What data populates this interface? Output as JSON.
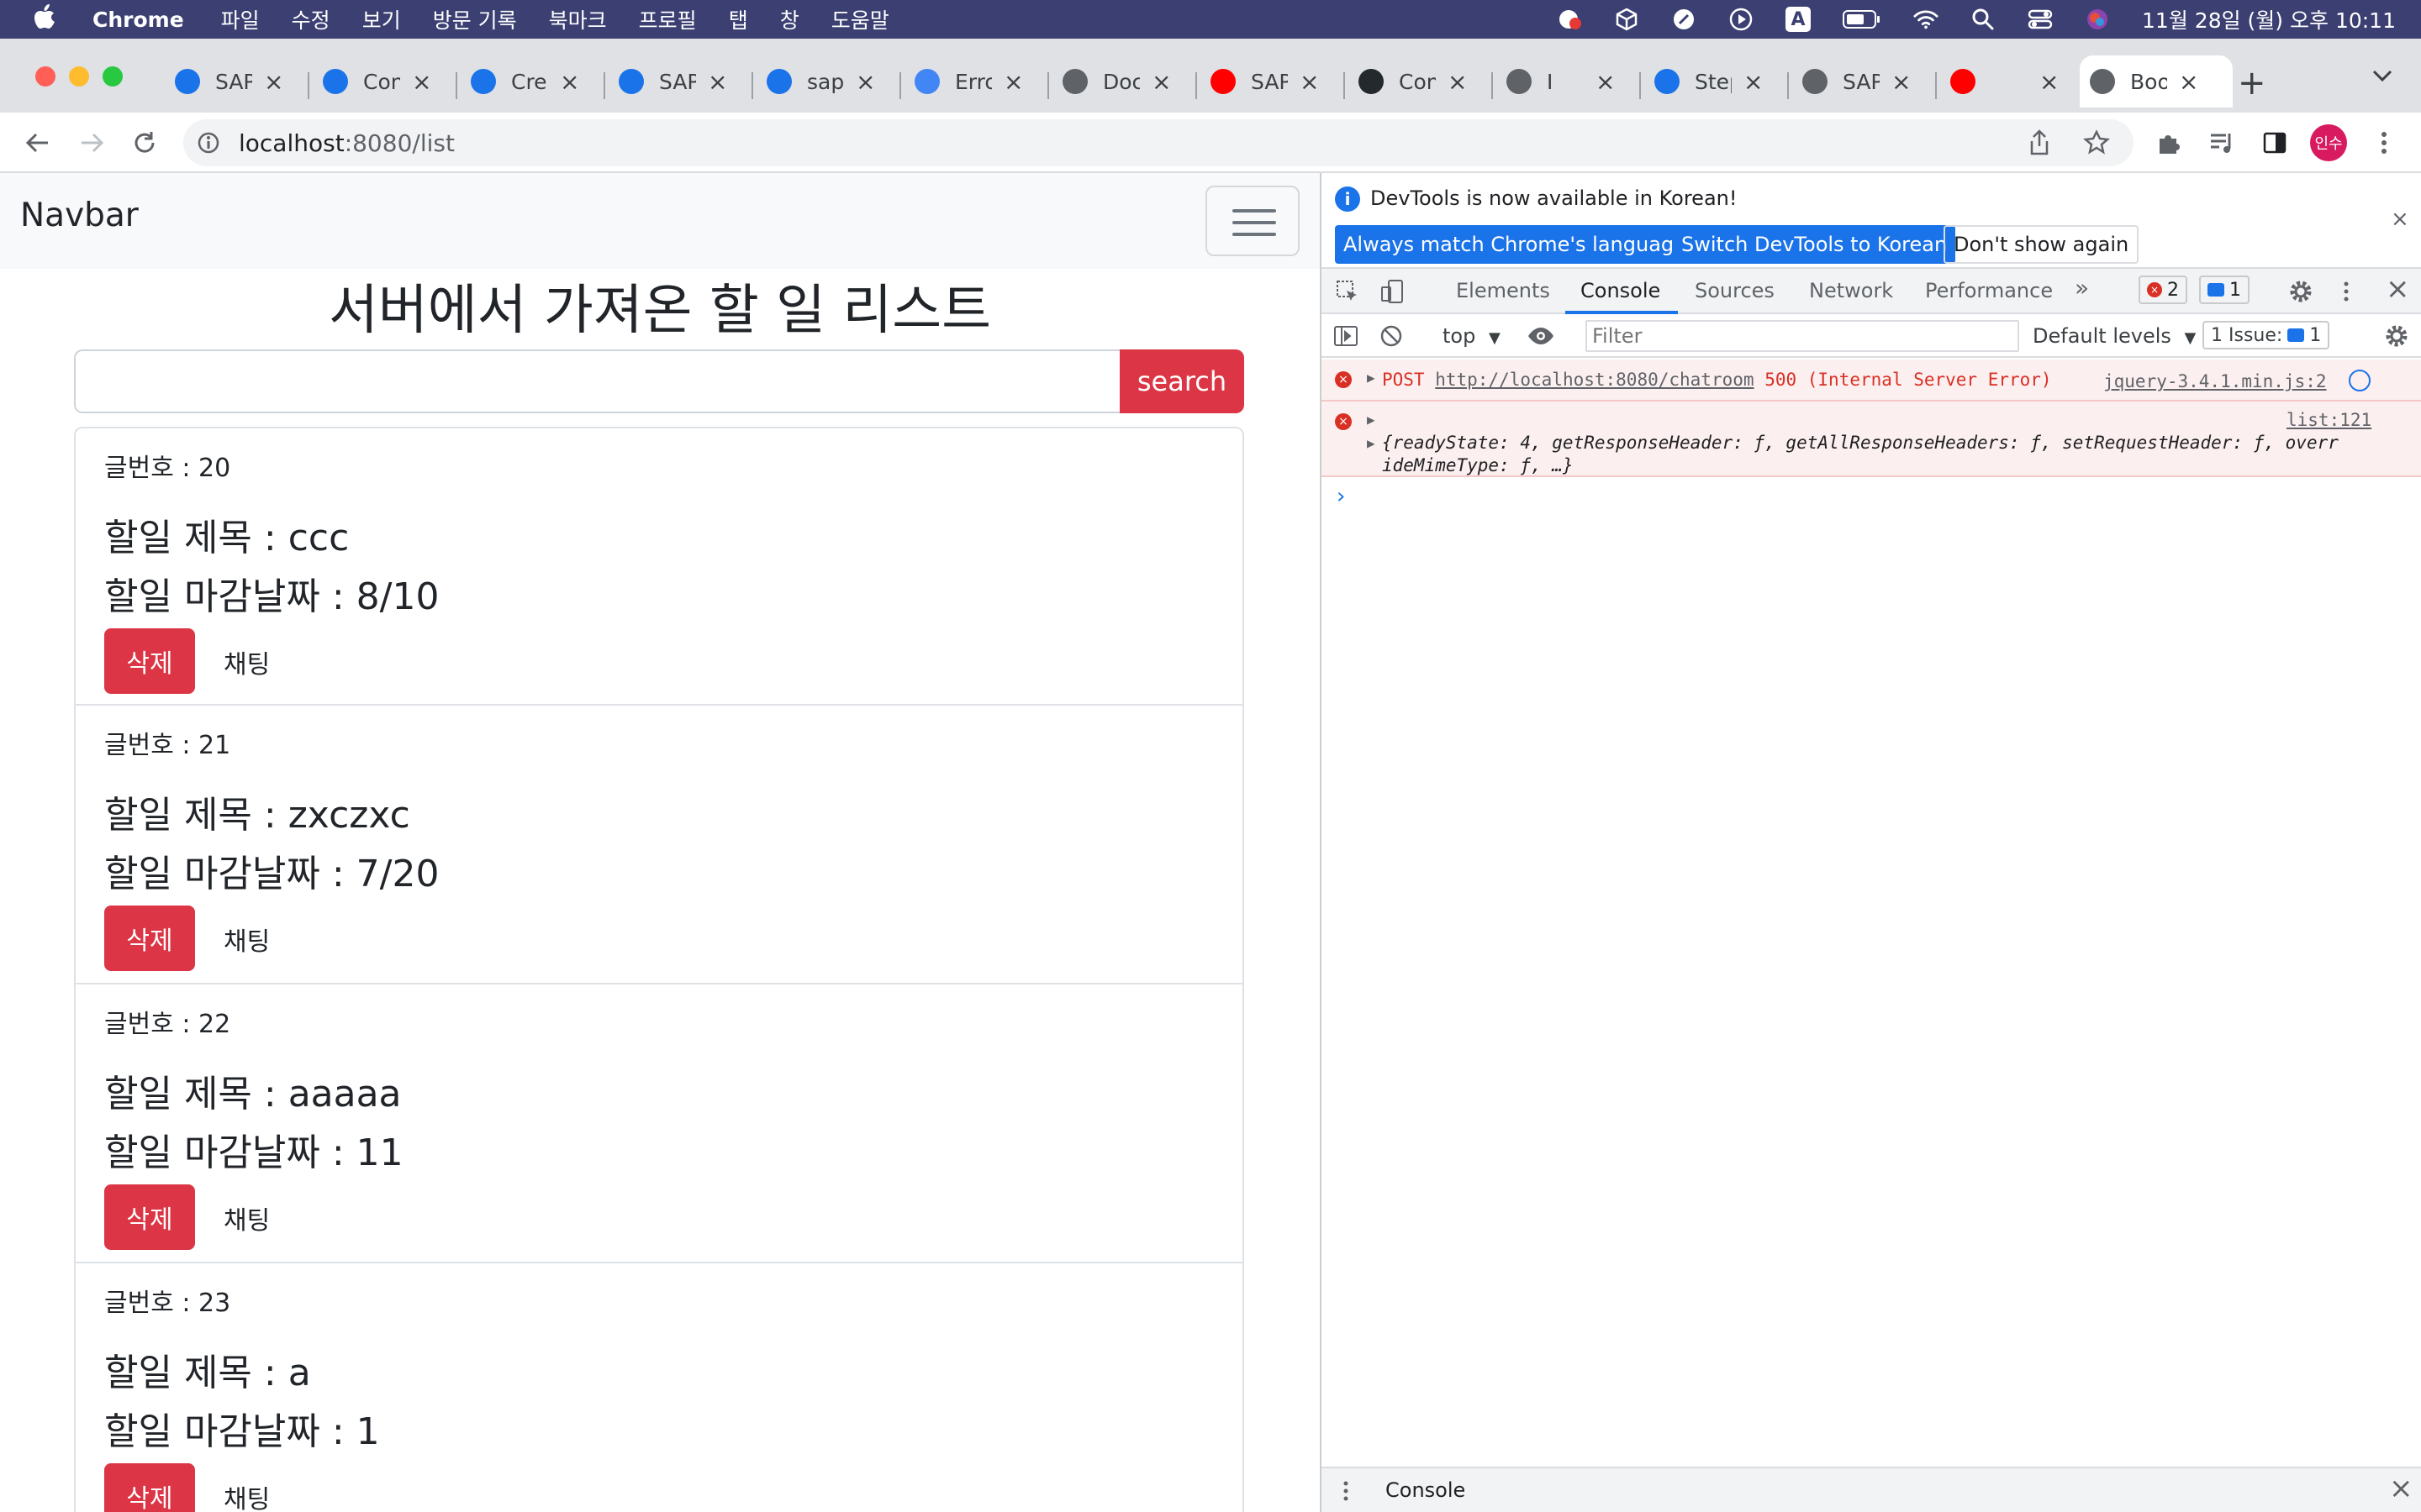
{
  "menubar": {
    "app": "Chrome",
    "items": [
      "파일",
      "수정",
      "보기",
      "방문 기록",
      "북마크",
      "프로필",
      "탭",
      "창",
      "도움말"
    ],
    "clock": "11월 28일 (월) 오후 10:11",
    "input_source": "A"
  },
  "tabs": [
    {
      "title": "SAP",
      "favicon": "sap-logo-icon",
      "color": "#1a73e8"
    },
    {
      "title": "Con",
      "favicon": "sap-logo-icon",
      "color": "#1a73e8"
    },
    {
      "title": "Crea",
      "favicon": "sap-logo-icon",
      "color": "#1a73e8"
    },
    {
      "title": "SAP",
      "favicon": "sap-logo-icon",
      "color": "#1a73e8"
    },
    {
      "title": "sape",
      "favicon": "sap-logo-icon",
      "color": "#1a73e8"
    },
    {
      "title": "Erro",
      "favicon": "google-icon",
      "color": "#4285f4"
    },
    {
      "title": "Doc",
      "favicon": "globe-icon",
      "color": "#5f6368"
    },
    {
      "title": "SAP",
      "favicon": "youtube-icon",
      "color": "#ff0000"
    },
    {
      "title": "Con",
      "favicon": "github-icon",
      "color": "#24292e"
    },
    {
      "title": "I",
      "favicon": "globe-icon",
      "color": "#5f6368"
    },
    {
      "title": "Step",
      "favicon": "globe-icon",
      "color": "#1a73e8"
    },
    {
      "title": "SAP",
      "favicon": "globe-icon",
      "color": "#5f6368"
    },
    {
      "title": "",
      "favicon": "youtube-icon",
      "color": "#ff0000"
    },
    {
      "title": "Boo",
      "favicon": "globe-icon",
      "color": "#5f6368",
      "active": true
    }
  ],
  "address": {
    "host": "localhost",
    "path": ":8080/list"
  },
  "profile_label": "인수",
  "page": {
    "brand": "Navbar",
    "heading": "서버에서 가져온 할 일 리스트",
    "search_placeholder": "",
    "search_label": "search",
    "delete_label": "삭제",
    "chat_label": "채팅",
    "posts": [
      {
        "num": "글번호 : 20",
        "title": "할일 제목 : ccc",
        "due": "할일 마감날짜 : 8/10"
      },
      {
        "num": "글번호 : 21",
        "title": "할일 제목 : zxczxc",
        "due": "할일 마감날짜 : 7/20"
      },
      {
        "num": "글번호 : 22",
        "title": "할일 제목 : aaaaa",
        "due": "할일 마감날짜 : 11"
      },
      {
        "num": "글번호 : 23",
        "title": "할일 제목 : a",
        "due": "할일 마감날짜 : 1"
      }
    ]
  },
  "devtools": {
    "info_text": "DevTools is now available in Korean!",
    "btn_match": "Always match Chrome's language",
    "btn_switch": "Switch DevTools to Korean",
    "btn_dont": "Don't show again",
    "tabs": [
      "Elements",
      "Console",
      "Sources",
      "Network",
      "Performance"
    ],
    "error_count": "2",
    "msg_count": "1",
    "context": "top",
    "filter_placeholder": "Filter",
    "levels": "Default levels",
    "issues_label": "1 Issue:",
    "issues_count": "1",
    "log": {
      "e1_method": "POST",
      "e1_url": "http://localhost:8080/chatroom",
      "e1_status": "500 (Internal Server Error)",
      "e1_source": "jquery-3.4.1.min.js:2",
      "e2_source": "list:121",
      "e2_line1": "{readyState: 4, getResponseHeader: ƒ, getAllResponseHeaders: ƒ, setRequestHeader: ƒ, overr",
      "e2_line2": "ideMimeType: ƒ, …}"
    },
    "drawer_tab": "Console"
  },
  "colors": {
    "menubar": "#3b3f72",
    "danger": "#dc3545",
    "devtools_accent": "#1a73e8",
    "error": "#d93025"
  }
}
